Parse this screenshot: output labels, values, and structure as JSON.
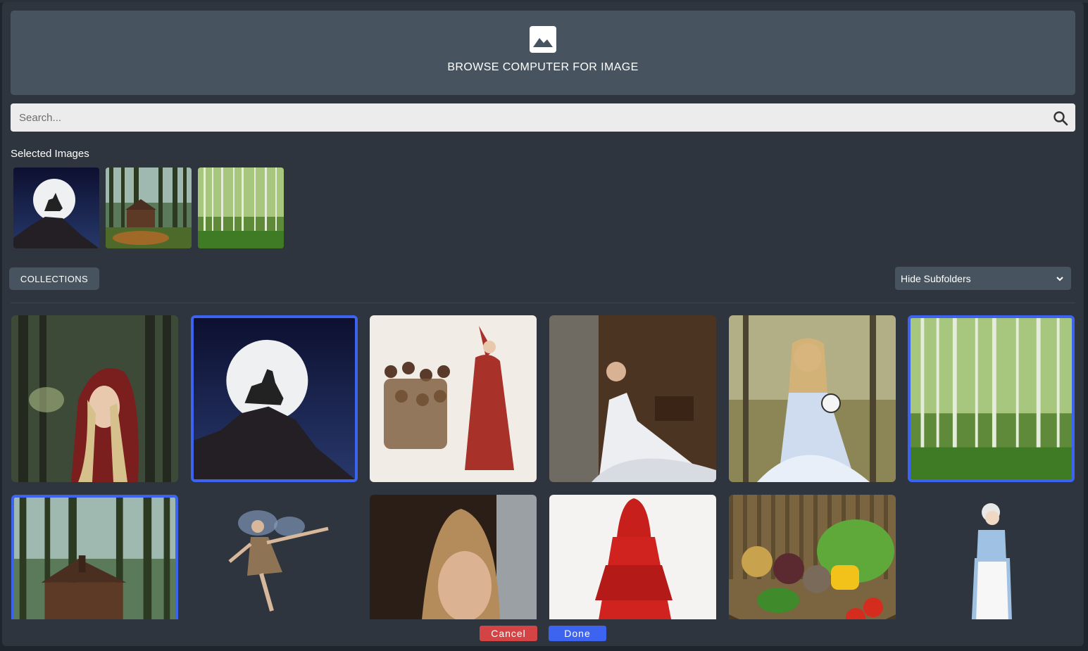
{
  "upload": {
    "label": "BROWSE COMPUTER FOR IMAGE",
    "icon": "image-icon"
  },
  "search": {
    "placeholder": "Search...",
    "value": "",
    "icon": "search-icon"
  },
  "selected": {
    "title": "Selected Images",
    "items": [
      {
        "icon": "wolf-moon-image"
      },
      {
        "icon": "forest-cabin-image"
      },
      {
        "icon": "birch-forest-image"
      }
    ]
  },
  "toolbar": {
    "collections_label": "COLLECTIONS",
    "subfolder_option": "Hide Subfolders"
  },
  "grid": {
    "items": [
      {
        "icon": "red-hood-girl-image",
        "selected": false
      },
      {
        "icon": "wolf-moon-image",
        "selected": true
      },
      {
        "icon": "pied-piper-image",
        "selected": false
      },
      {
        "icon": "woman-white-dress-image",
        "selected": false
      },
      {
        "icon": "girl-with-clock-image",
        "selected": false
      },
      {
        "icon": "birch-forest-image",
        "selected": true
      },
      {
        "icon": "forest-cabin-image",
        "selected": true
      },
      {
        "icon": "fairy-image",
        "selected": false
      },
      {
        "icon": "girl-portrait-image",
        "selected": false
      },
      {
        "icon": "red-cloak-image",
        "selected": false
      },
      {
        "icon": "vegetable-basket-image",
        "selected": false
      },
      {
        "icon": "grandmother-image",
        "selected": false
      }
    ]
  },
  "footer": {
    "cancel_label": "Cancel",
    "done_label": "Done"
  },
  "colors": {
    "accent": "#3d64f0",
    "danger": "#d54444",
    "panel": "#47545f",
    "modal": "#2e353e"
  }
}
